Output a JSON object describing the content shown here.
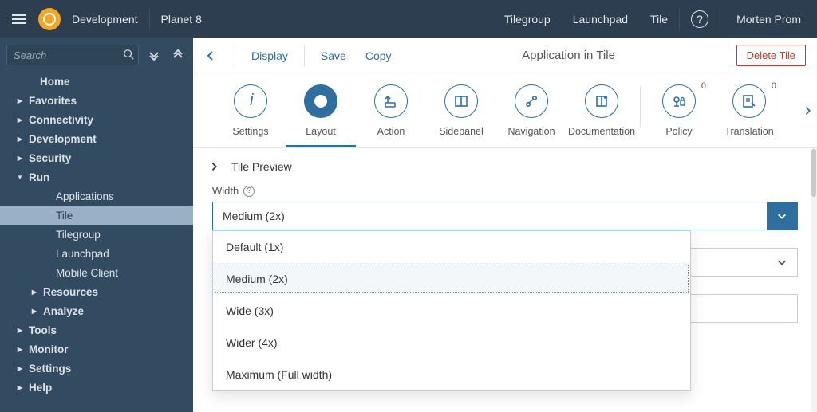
{
  "header": {
    "context": "Development",
    "app": "Planet 8",
    "links": [
      "Tilegroup",
      "Launchpad",
      "Tile"
    ],
    "user": "Morten Prom"
  },
  "nav": {
    "search_placeholder": "Search",
    "items": [
      {
        "label": "Home",
        "level": 0,
        "kind": "home"
      },
      {
        "label": "Favorites",
        "level": 0,
        "expand": "closed"
      },
      {
        "label": "Connectivity",
        "level": 0,
        "expand": "closed"
      },
      {
        "label": "Development",
        "level": 0,
        "expand": "closed"
      },
      {
        "label": "Security",
        "level": 0,
        "expand": "closed"
      },
      {
        "label": "Run",
        "level": 0,
        "expand": "open"
      },
      {
        "label": "Applications",
        "level": 1
      },
      {
        "label": "Tile",
        "level": 1,
        "selected": true
      },
      {
        "label": "Tilegroup",
        "level": 1
      },
      {
        "label": "Launchpad",
        "level": 1
      },
      {
        "label": "Mobile Client",
        "level": 1
      },
      {
        "label": "Resources",
        "level": 1,
        "expand": "closed",
        "sub": true
      },
      {
        "label": "Analyze",
        "level": 1,
        "expand": "closed",
        "sub": true
      },
      {
        "label": "Tools",
        "level": 0,
        "expand": "closed"
      },
      {
        "label": "Monitor",
        "level": 0,
        "expand": "closed"
      },
      {
        "label": "Settings",
        "level": 0,
        "expand": "closed"
      },
      {
        "label": "Help",
        "level": 0,
        "expand": "closed"
      }
    ]
  },
  "toolbar": {
    "actions": {
      "display": "Display",
      "save": "Save",
      "copy": "Copy"
    },
    "title": "Application in Tile",
    "delete": "Delete Tile"
  },
  "tabs": [
    {
      "id": "settings",
      "label": "Settings",
      "icon": "info"
    },
    {
      "id": "layout",
      "label": "Layout",
      "icon": "palette",
      "active": true
    },
    {
      "id": "action",
      "label": "Action",
      "icon": "share"
    },
    {
      "id": "sidepanel",
      "label": "Sidepanel",
      "icon": "panel"
    },
    {
      "id": "navigation",
      "label": "Navigation",
      "icon": "route"
    },
    {
      "id": "documentation",
      "label": "Documentation",
      "icon": "book"
    },
    {
      "id": "policy",
      "label": "Policy",
      "icon": "lock",
      "badge": "0"
    },
    {
      "id": "translation",
      "label": "Translation",
      "icon": "edit",
      "badge": "0"
    }
  ],
  "preview": {
    "title": "Tile Preview"
  },
  "fields": {
    "width": {
      "label": "Width",
      "value": "Medium (2x)",
      "options": [
        "Default (1x)",
        "Medium (2x)",
        "Wide (3x)",
        "Wider (4x)",
        "Maximum (Full width)"
      ]
    }
  }
}
